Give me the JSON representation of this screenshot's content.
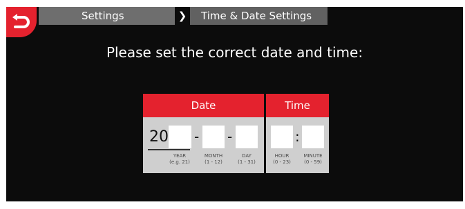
{
  "header": {
    "breadcrumb": {
      "parent": "Settings",
      "separator": "❯",
      "current": "Time & Date Settings"
    }
  },
  "main": {
    "prompt": "Please set the correct date and time:",
    "date": {
      "title": "Date",
      "year_prefix": "20",
      "separator": "-",
      "fields": [
        {
          "label": "YEAR",
          "hint": "(e.g. 21)",
          "value": ""
        },
        {
          "label": "MONTH",
          "hint": "(1 - 12)",
          "value": ""
        },
        {
          "label": "DAY",
          "hint": "(1 - 31)",
          "value": ""
        }
      ]
    },
    "time": {
      "title": "Time",
      "separator": ":",
      "fields": [
        {
          "label": "HOUR",
          "hint": "(0 - 23)",
          "value": ""
        },
        {
          "label": "MINUTE",
          "hint": "(0 - 59)",
          "value": ""
        }
      ]
    }
  },
  "colors": {
    "accent": "#e4222e",
    "background": "#0c0c0c",
    "tab": "#6e6e6e",
    "panel": "#cfcfcf"
  },
  "icons": {
    "back": "back-arrow-icon"
  }
}
